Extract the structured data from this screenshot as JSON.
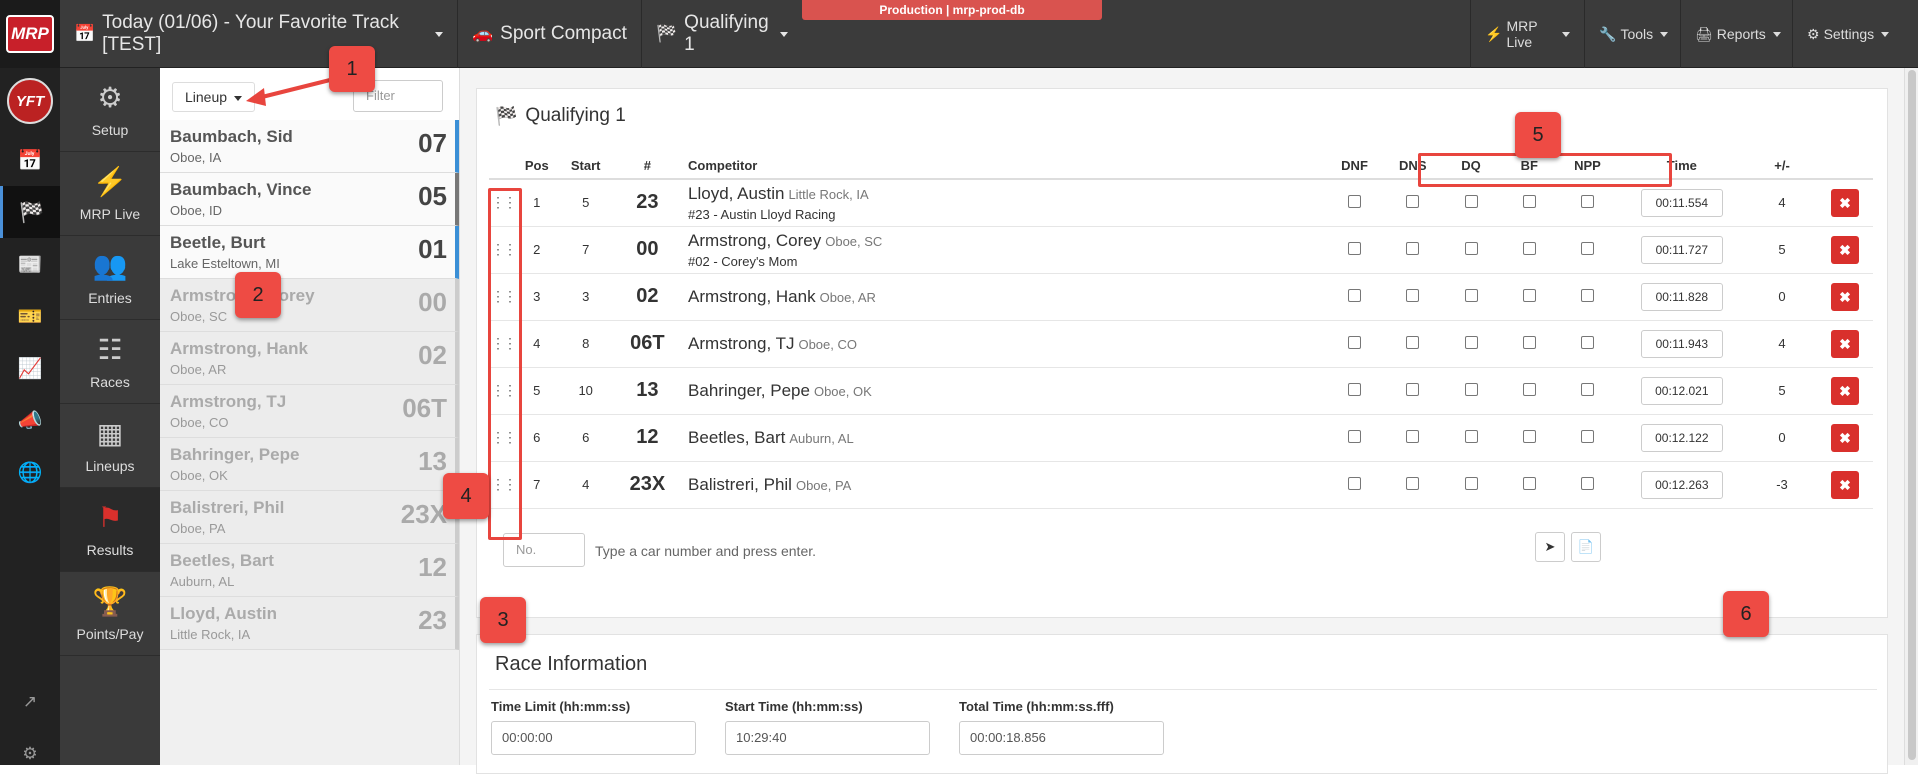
{
  "banner": "Production | mrp-prod-db",
  "topnav": {
    "event": "Today (01/06) - Your Favorite Track [TEST]",
    "class": "Sport Compact",
    "session": "Qualifying 1",
    "right": [
      "MRP Live",
      "Tools",
      "Reports",
      "Settings"
    ]
  },
  "logo_text": "MRP",
  "yft_text": "YFT",
  "sidenav": [
    "Setup",
    "MRP Live",
    "Entries",
    "Races",
    "Lineups",
    "Results",
    "Points/Pay"
  ],
  "lineup": {
    "button": "Lineup",
    "filter_placeholder": "Filter",
    "items": [
      {
        "name": "Baumbach, Sid",
        "loc": "Oboe, IA",
        "no": "07"
      },
      {
        "name": "Baumbach, Vince",
        "loc": "Oboe, ID",
        "no": "05"
      },
      {
        "name": "Beetle, Burt",
        "loc": "Lake Esteltown, MI",
        "no": "01"
      },
      {
        "name": "Armstrong, Corey",
        "loc": "Oboe, SC",
        "no": "00"
      },
      {
        "name": "Armstrong, Hank",
        "loc": "Oboe, AR",
        "no": "02"
      },
      {
        "name": "Armstrong, TJ",
        "loc": "Oboe, CO",
        "no": "06T"
      },
      {
        "name": "Bahringer, Pepe",
        "loc": "Oboe, OK",
        "no": "13"
      },
      {
        "name": "Balistreri, Phil",
        "loc": "Oboe, PA",
        "no": "23X"
      },
      {
        "name": "Beetles, Bart",
        "loc": "Auburn, AL",
        "no": "12"
      },
      {
        "name": "Lloyd, Austin",
        "loc": "Little Rock, IA",
        "no": "23"
      }
    ]
  },
  "results": {
    "title": "Qualifying 1",
    "headers": {
      "pos": "Pos",
      "start": "Start",
      "num": "#",
      "competitor": "Competitor",
      "dnf": "DNF",
      "dns": "DNS",
      "dq": "DQ",
      "bf": "BF",
      "npp": "NPP",
      "time": "Time",
      "plusminus": "+/-"
    },
    "rows": [
      {
        "pos": "1",
        "start": "5",
        "num": "23",
        "name": "Lloyd, Austin",
        "loc": "Little Rock, IA",
        "team": "#23 - Austin Lloyd Racing",
        "time": "00:11.554",
        "pm": "4"
      },
      {
        "pos": "2",
        "start": "7",
        "num": "00",
        "name": "Armstrong, Corey",
        "loc": "Oboe, SC",
        "team": "#02 - Corey's Mom",
        "time": "00:11.727",
        "pm": "5"
      },
      {
        "pos": "3",
        "start": "3",
        "num": "02",
        "name": "Armstrong, Hank",
        "loc": "Oboe, AR",
        "team": "",
        "time": "00:11.828",
        "pm": "0"
      },
      {
        "pos": "4",
        "start": "8",
        "num": "06T",
        "name": "Armstrong, TJ",
        "loc": "Oboe, CO",
        "team": "",
        "time": "00:11.943",
        "pm": "4"
      },
      {
        "pos": "5",
        "start": "10",
        "num": "13",
        "name": "Bahringer, Pepe",
        "loc": "Oboe, OK",
        "team": "",
        "time": "00:12.021",
        "pm": "5"
      },
      {
        "pos": "6",
        "start": "6",
        "num": "12",
        "name": "Beetles, Bart",
        "loc": "Auburn, AL",
        "team": "",
        "time": "00:12.122",
        "pm": "0"
      },
      {
        "pos": "7",
        "start": "4",
        "num": "23X",
        "name": "Balistreri, Phil",
        "loc": "Oboe, PA",
        "team": "",
        "time": "00:12.263",
        "pm": "-3"
      }
    ],
    "add_placeholder": "No.",
    "add_hint": "Type a car number and press enter."
  },
  "race_info": {
    "title": "Race Information",
    "fields": [
      {
        "label": "Time Limit (hh:mm:ss)",
        "value": "00:00:00"
      },
      {
        "label": "Start Time (hh:mm:ss)",
        "value": "10:29:40"
      },
      {
        "label": "Total Time (hh:mm:ss.fff)",
        "value": "00:00:18.856"
      }
    ]
  },
  "callouts": [
    "1",
    "2",
    "3",
    "4",
    "5",
    "6"
  ],
  "colors": {
    "accent_red": "#d9302c",
    "callout": "#ee4b44",
    "active_blue": "#3a8fd6"
  }
}
